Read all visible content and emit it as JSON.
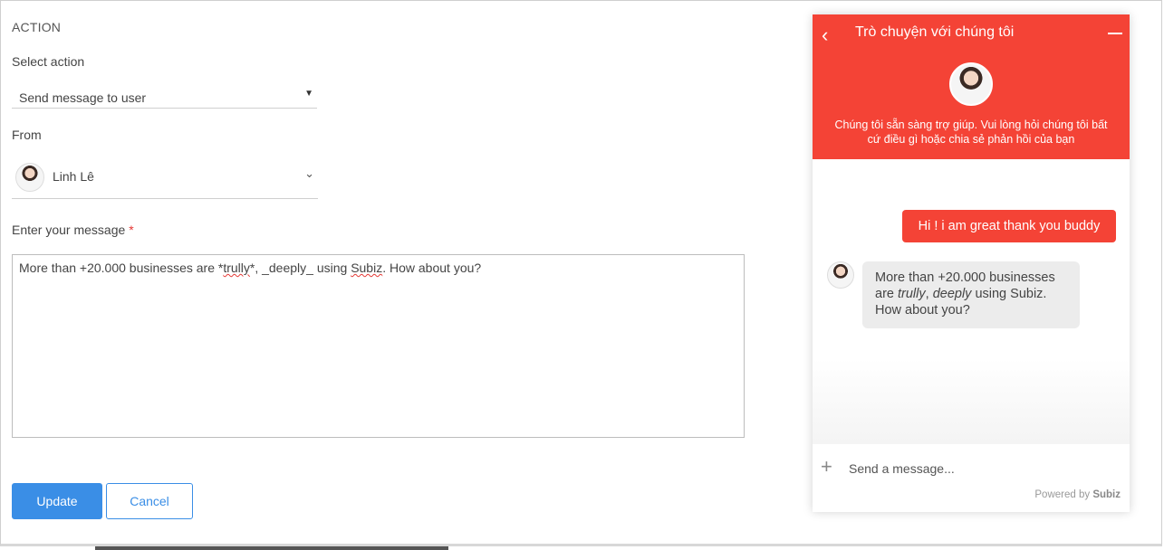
{
  "form": {
    "section_title": "ACTION",
    "select_action_label": "Select action",
    "select_action_value": "Send message to user",
    "select_caret": "▼",
    "from_label": "From",
    "from_value": "Linh Lê",
    "from_chevron": "⌄",
    "message_label": "Enter your message",
    "required_mark": "*",
    "message_parts": {
      "p1": "More than +20.000 businesses are *",
      "p2": "trully",
      "p3": "*, _deeply_ using ",
      "p4": "Subiz",
      "p5": ". How about you?"
    },
    "update_label": "Update",
    "cancel_label": "Cancel"
  },
  "widget": {
    "back_icon": "‹",
    "title": "Trò chuyện với chúng tôi",
    "tagline": "Chúng tôi sẵn sàng trợ giúp. Vui lòng hỏi chúng tôi bất cứ điều gì hoặc chia sẻ phản hồi của bạn",
    "outgoing_message": "Hi ! i am great thank you buddy",
    "incoming_message": {
      "p1": "More than +20.000 businesses are ",
      "p2": "trully",
      "p3": ", ",
      "p4": "deeply",
      "p5": " using Subiz. How about you?"
    },
    "plus_icon": "+",
    "input_placeholder": "Send a message...",
    "powered_prefix": "Powered by ",
    "powered_brand": "Subiz"
  },
  "colors": {
    "accent_red": "#f44336",
    "primary_blue": "#3a8ee6"
  }
}
